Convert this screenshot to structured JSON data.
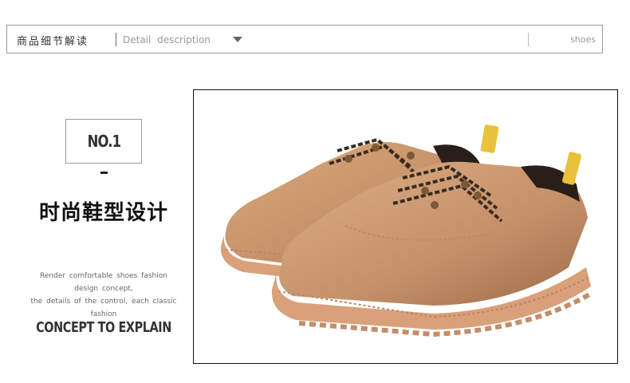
{
  "header": {
    "title_cn": "商品细节解读",
    "title_en": "Detail  description",
    "dropdown_icon": "triangle-down-icon",
    "right_label": "shoes"
  },
  "feature": {
    "number_label": "NO.1",
    "heading_cn": "时尚鞋型设计",
    "description_lines": [
      "Render comfortable shoes fashion",
      "design concept,",
      "the details of the control, each classic fashion"
    ],
    "subheading_en": "CONCEPT TO EXPLAIN"
  },
  "product_image": {
    "subject": "tan leather lace-up work shoes",
    "colors": {
      "leather": "#c8936a",
      "sole": "#d9a07a",
      "lace": "#3a2a1e",
      "tab": "#e8c23a"
    }
  }
}
